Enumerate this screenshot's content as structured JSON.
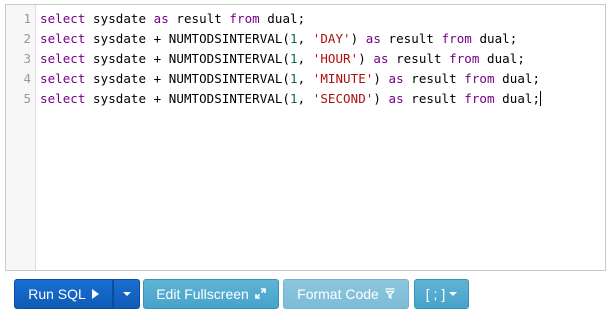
{
  "editor": {
    "line_numbers": [
      "1",
      "2",
      "3",
      "4",
      "5"
    ],
    "lines": [
      [
        {
          "t": "select",
          "c": "kw"
        },
        {
          "t": " sysdate "
        },
        {
          "t": "as",
          "c": "kw"
        },
        {
          "t": " result "
        },
        {
          "t": "from",
          "c": "kw"
        },
        {
          "t": " dual;"
        }
      ],
      [
        {
          "t": "select",
          "c": "kw"
        },
        {
          "t": " sysdate + NUMTODSINTERVAL("
        },
        {
          "t": "1",
          "c": "num"
        },
        {
          "t": ", "
        },
        {
          "t": "'DAY'",
          "c": "str"
        },
        {
          "t": ") "
        },
        {
          "t": "as",
          "c": "kw"
        },
        {
          "t": " result "
        },
        {
          "t": "from",
          "c": "kw"
        },
        {
          "t": " dual;"
        }
      ],
      [
        {
          "t": "select",
          "c": "kw"
        },
        {
          "t": " sysdate + NUMTODSINTERVAL("
        },
        {
          "t": "1",
          "c": "num"
        },
        {
          "t": ", "
        },
        {
          "t": "'HOUR'",
          "c": "str"
        },
        {
          "t": ") "
        },
        {
          "t": "as",
          "c": "kw"
        },
        {
          "t": " result "
        },
        {
          "t": "from",
          "c": "kw"
        },
        {
          "t": " dual;"
        }
      ],
      [
        {
          "t": "select",
          "c": "kw"
        },
        {
          "t": " sysdate + NUMTODSINTERVAL("
        },
        {
          "t": "1",
          "c": "num"
        },
        {
          "t": ", "
        },
        {
          "t": "'MINUTE'",
          "c": "str"
        },
        {
          "t": ") "
        },
        {
          "t": "as",
          "c": "kw"
        },
        {
          "t": " result "
        },
        {
          "t": "from",
          "c": "kw"
        },
        {
          "t": " dual;"
        }
      ],
      [
        {
          "t": "select",
          "c": "kw"
        },
        {
          "t": " sysdate + NUMTODSINTERVAL("
        },
        {
          "t": "1",
          "c": "num"
        },
        {
          "t": ", "
        },
        {
          "t": "'SECOND'",
          "c": "str"
        },
        {
          "t": ") "
        },
        {
          "t": "as",
          "c": "kw"
        },
        {
          "t": " result "
        },
        {
          "t": "from",
          "c": "kw"
        },
        {
          "t": " dual;"
        }
      ]
    ]
  },
  "toolbar": {
    "run_label": "Run SQL",
    "run_icon": "play-icon",
    "run_menu_icon": "caret-down-icon",
    "fullscreen_label": "Edit Fullscreen",
    "fullscreen_icon": "expand-arrows-icon",
    "format_label": "Format Code",
    "format_icon": "filter-icon",
    "terminator_label": "[ ; ]",
    "terminator_icon": "caret-down-icon"
  },
  "colors": {
    "keyword": "#770088",
    "string": "#aa1111",
    "number": "#116644",
    "run_button": "#1467c9",
    "info_button": "#55acd0"
  }
}
